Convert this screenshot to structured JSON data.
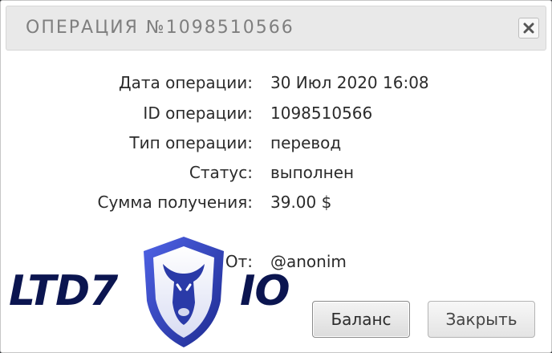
{
  "dialog": {
    "title": "ОПЕРАЦИЯ №1098510566",
    "close_icon": "close-x-icon"
  },
  "details": [
    {
      "label": "Дата операции:",
      "value": "30 Июл 2020 16:08"
    },
    {
      "label": "ID операции:",
      "value": "1098510566"
    },
    {
      "label": "Тип операции:",
      "value": "перевод"
    },
    {
      "label": "Статус:",
      "value": "выполнен"
    },
    {
      "label": "Сумма получения:",
      "value": "39.00 $"
    }
  ],
  "from": {
    "label": "От:",
    "value": "@anonim"
  },
  "watermark": {
    "left_text": "LTD7",
    "right_text": "IO"
  },
  "buttons": {
    "balance": "Баланс",
    "close": "Закрыть"
  },
  "colors": {
    "title_text": "#7f7f7f",
    "watermark_text": "#0b1550",
    "shield": "#3a4fd0"
  }
}
